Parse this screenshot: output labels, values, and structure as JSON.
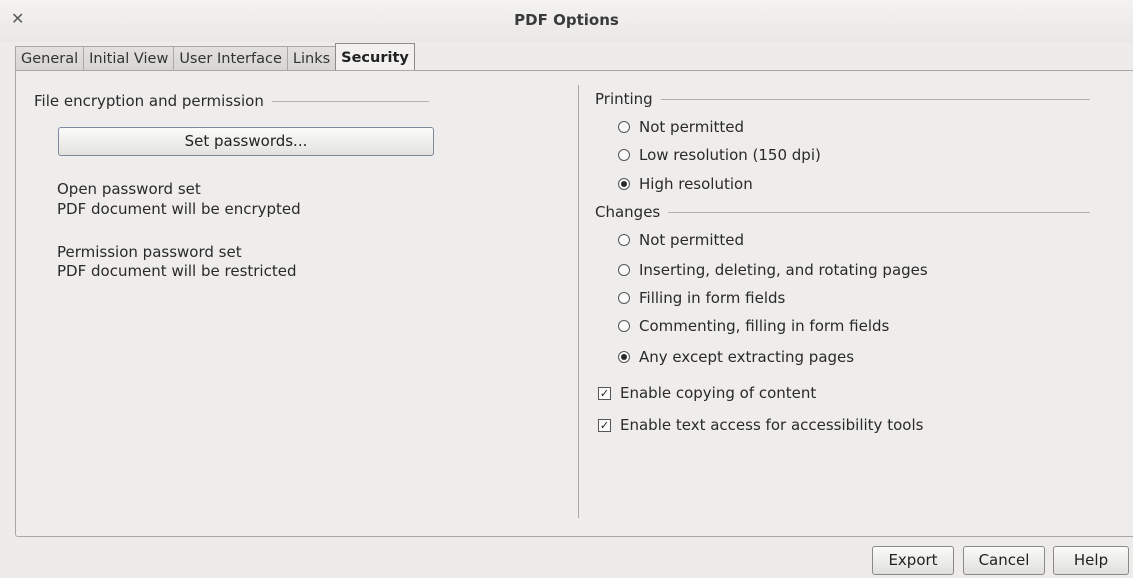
{
  "window": {
    "title": "PDF Options"
  },
  "tabs": [
    {
      "label": "General",
      "active": false
    },
    {
      "label": "Initial View",
      "active": false
    },
    {
      "label": "User Interface",
      "active": false
    },
    {
      "label": "Links",
      "active": false
    },
    {
      "label": "Security",
      "active": true
    }
  ],
  "encryption": {
    "header": "File encryption and permission",
    "set_passwords_button": "Set passwords...",
    "open_password_status": "Open password set",
    "open_password_detail": "PDF document will be encrypted",
    "permission_password_status": "Permission password set",
    "permission_password_detail": "PDF document will be restricted"
  },
  "printing": {
    "header": "Printing",
    "options": [
      {
        "label": "Not permitted",
        "checked": false
      },
      {
        "label": "Low resolution (150 dpi)",
        "checked": false
      },
      {
        "label": "High resolution",
        "checked": true
      }
    ]
  },
  "changes": {
    "header": "Changes",
    "options": [
      {
        "label": "Not permitted",
        "checked": false
      },
      {
        "label": "Inserting, deleting, and rotating pages",
        "checked": false
      },
      {
        "label": "Filling in form fields",
        "checked": false
      },
      {
        "label": "Commenting, filling in form fields",
        "checked": false
      },
      {
        "label": "Any except extracting pages",
        "checked": true
      }
    ]
  },
  "checkboxes": [
    {
      "label": "Enable copying of content",
      "checked": true
    },
    {
      "label": "Enable text access for accessibility tools",
      "checked": true
    }
  ],
  "buttons": {
    "export": "Export",
    "cancel": "Cancel",
    "help": "Help"
  },
  "icons": {
    "close": "close-icon"
  }
}
